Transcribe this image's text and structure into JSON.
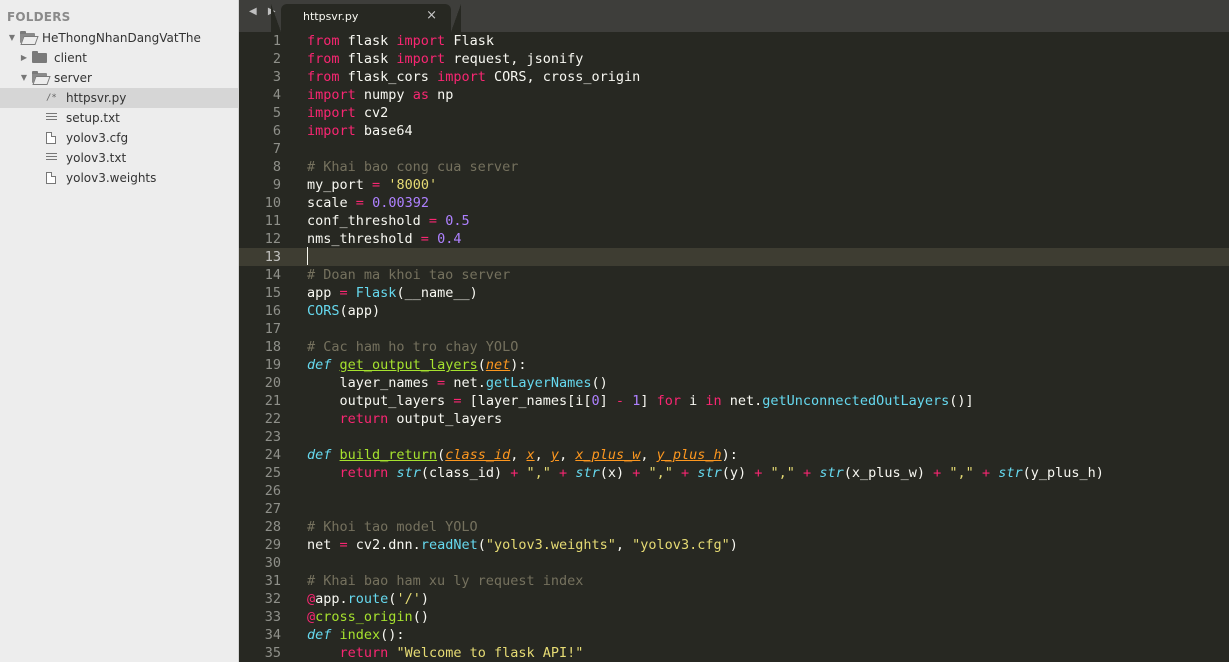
{
  "sidebar": {
    "header": "FOLDERS",
    "items": [
      {
        "label": "HeThongNhanDangVatThe",
        "kind": "folder-open",
        "depth": 0,
        "arrow": "▼"
      },
      {
        "label": "client",
        "kind": "folder",
        "depth": 1,
        "arrow": "▶"
      },
      {
        "label": "server",
        "kind": "folder-open",
        "depth": 1,
        "arrow": "▼"
      },
      {
        "label": "httpsvr.py",
        "kind": "py",
        "depth": 2,
        "selected": true,
        "icon_glyph": "/*"
      },
      {
        "label": "setup.txt",
        "kind": "txt",
        "depth": 2
      },
      {
        "label": "yolov3.cfg",
        "kind": "file",
        "depth": 2
      },
      {
        "label": "yolov3.txt",
        "kind": "txt",
        "depth": 2
      },
      {
        "label": "yolov3.weights",
        "kind": "file",
        "depth": 2
      }
    ]
  },
  "tabbar": {
    "nav_arrows": "◀ ▶",
    "active_tab": {
      "title": "httpsvr.py",
      "close_glyph": "×"
    }
  },
  "editor": {
    "current_line": 13,
    "colors": {
      "background": "#272822",
      "keyword": "#f92672",
      "comment": "#75715e",
      "string": "#e6db74",
      "number": "#ae81ff",
      "function": "#a6e22e",
      "builtin": "#66d9ef",
      "param": "#fd971f"
    },
    "lines": [
      {
        "n": "1",
        "tokens": [
          [
            "k",
            "from"
          ],
          [
            "x",
            " flask "
          ],
          [
            "k",
            "import"
          ],
          [
            "x",
            " Flask"
          ]
        ]
      },
      {
        "n": "2",
        "tokens": [
          [
            "k",
            "from"
          ],
          [
            "x",
            " flask "
          ],
          [
            "k",
            "import"
          ],
          [
            "x",
            " request, jsonify"
          ]
        ]
      },
      {
        "n": "3",
        "tokens": [
          [
            "k",
            "from"
          ],
          [
            "x",
            " flask_cors "
          ],
          [
            "k",
            "import"
          ],
          [
            "x",
            " CORS, cross_origin"
          ]
        ]
      },
      {
        "n": "4",
        "tokens": [
          [
            "k",
            "import"
          ],
          [
            "x",
            " numpy "
          ],
          [
            "k",
            "as"
          ],
          [
            "x",
            " np"
          ]
        ]
      },
      {
        "n": "5",
        "tokens": [
          [
            "k",
            "import"
          ],
          [
            "x",
            " cv2"
          ]
        ]
      },
      {
        "n": "6",
        "tokens": [
          [
            "k",
            "import"
          ],
          [
            "x",
            " base64"
          ]
        ]
      },
      {
        "n": "7",
        "tokens": []
      },
      {
        "n": "8",
        "tokens": [
          [
            "c",
            "# Khai bao cong cua server"
          ]
        ]
      },
      {
        "n": "9",
        "tokens": [
          [
            "x",
            "my_port "
          ],
          [
            "k",
            "="
          ],
          [
            "x",
            " "
          ],
          [
            "s",
            "'8000'"
          ]
        ]
      },
      {
        "n": "10",
        "tokens": [
          [
            "x",
            "scale "
          ],
          [
            "k",
            "="
          ],
          [
            "x",
            " "
          ],
          [
            "n",
            "0.00392"
          ]
        ]
      },
      {
        "n": "11",
        "tokens": [
          [
            "x",
            "conf_threshold "
          ],
          [
            "k",
            "="
          ],
          [
            "x",
            " "
          ],
          [
            "n",
            "0.5"
          ]
        ]
      },
      {
        "n": "12",
        "tokens": [
          [
            "x",
            "nms_threshold "
          ],
          [
            "k",
            "="
          ],
          [
            "x",
            " "
          ],
          [
            "n",
            "0.4"
          ]
        ]
      },
      {
        "n": "13",
        "tokens": []
      },
      {
        "n": "14",
        "tokens": [
          [
            "c",
            "# Doan ma khoi tao server"
          ]
        ]
      },
      {
        "n": "15",
        "tokens": [
          [
            "x",
            "app "
          ],
          [
            "k",
            "="
          ],
          [
            "x",
            " "
          ],
          [
            "b",
            "Flask"
          ],
          [
            "x",
            "(__name__)"
          ]
        ]
      },
      {
        "n": "16",
        "tokens": [
          [
            "b",
            "CORS"
          ],
          [
            "x",
            "(app)"
          ]
        ]
      },
      {
        "n": "17",
        "tokens": []
      },
      {
        "n": "18",
        "tokens": [
          [
            "c",
            "# Cac ham ho tro chay YOLO"
          ]
        ]
      },
      {
        "n": "19",
        "tokens": [
          [
            "bi",
            "def"
          ],
          [
            "x",
            " "
          ],
          [
            "fu",
            "get_output_layers"
          ],
          [
            "x",
            "("
          ],
          [
            "pu",
            "net"
          ],
          [
            "x",
            "):"
          ]
        ]
      },
      {
        "n": "20",
        "tokens": [
          [
            "x",
            "    layer_names "
          ],
          [
            "k",
            "="
          ],
          [
            "x",
            " net."
          ],
          [
            "b",
            "getLayerNames"
          ],
          [
            "x",
            "()"
          ]
        ]
      },
      {
        "n": "21",
        "tokens": [
          [
            "x",
            "    output_layers "
          ],
          [
            "k",
            "="
          ],
          [
            "x",
            " [layer_names[i["
          ],
          [
            "n",
            "0"
          ],
          [
            "x",
            "] "
          ],
          [
            "k",
            "-"
          ],
          [
            "x",
            " "
          ],
          [
            "n",
            "1"
          ],
          [
            "x",
            "] "
          ],
          [
            "k",
            "for"
          ],
          [
            "x",
            " i "
          ],
          [
            "k",
            "in"
          ],
          [
            "x",
            " net."
          ],
          [
            "b",
            "getUnconnectedOutLayers"
          ],
          [
            "x",
            "()]"
          ]
        ]
      },
      {
        "n": "22",
        "tokens": [
          [
            "x",
            "    "
          ],
          [
            "k",
            "return"
          ],
          [
            "x",
            " output_layers"
          ]
        ]
      },
      {
        "n": "23",
        "tokens": []
      },
      {
        "n": "24",
        "tokens": [
          [
            "bi",
            "def"
          ],
          [
            "x",
            " "
          ],
          [
            "fu",
            "build_return"
          ],
          [
            "x",
            "("
          ],
          [
            "pu",
            "class_id"
          ],
          [
            "x",
            ", "
          ],
          [
            "pu",
            "x"
          ],
          [
            "x",
            ", "
          ],
          [
            "pu",
            "y"
          ],
          [
            "x",
            ", "
          ],
          [
            "pu",
            "x_plus_w"
          ],
          [
            "x",
            ", "
          ],
          [
            "pu",
            "y_plus_h"
          ],
          [
            "x",
            "):"
          ]
        ]
      },
      {
        "n": "25",
        "tokens": [
          [
            "x",
            "    "
          ],
          [
            "k",
            "return"
          ],
          [
            "x",
            " "
          ],
          [
            "bi",
            "str"
          ],
          [
            "x",
            "(class_id) "
          ],
          [
            "k",
            "+"
          ],
          [
            "x",
            " "
          ],
          [
            "s",
            "\",\""
          ],
          [
            "x",
            " "
          ],
          [
            "k",
            "+"
          ],
          [
            "x",
            " "
          ],
          [
            "bi",
            "str"
          ],
          [
            "x",
            "(x) "
          ],
          [
            "k",
            "+"
          ],
          [
            "x",
            " "
          ],
          [
            "s",
            "\",\""
          ],
          [
            "x",
            " "
          ],
          [
            "k",
            "+"
          ],
          [
            "x",
            " "
          ],
          [
            "bi",
            "str"
          ],
          [
            "x",
            "(y) "
          ],
          [
            "k",
            "+"
          ],
          [
            "x",
            " "
          ],
          [
            "s",
            "\",\""
          ],
          [
            "x",
            " "
          ],
          [
            "k",
            "+"
          ],
          [
            "x",
            " "
          ],
          [
            "bi",
            "str"
          ],
          [
            "x",
            "(x_plus_w) "
          ],
          [
            "k",
            "+"
          ],
          [
            "x",
            " "
          ],
          [
            "s",
            "\",\""
          ],
          [
            "x",
            " "
          ],
          [
            "k",
            "+"
          ],
          [
            "x",
            " "
          ],
          [
            "bi",
            "str"
          ],
          [
            "x",
            "(y_plus_h)"
          ]
        ]
      },
      {
        "n": "26",
        "tokens": []
      },
      {
        "n": "27",
        "tokens": []
      },
      {
        "n": "28",
        "tokens": [
          [
            "c",
            "# Khoi tao model YOLO"
          ]
        ]
      },
      {
        "n": "29",
        "tokens": [
          [
            "x",
            "net "
          ],
          [
            "k",
            "="
          ],
          [
            "x",
            " cv2.dnn."
          ],
          [
            "b",
            "readNet"
          ],
          [
            "x",
            "("
          ],
          [
            "s",
            "\"yolov3.weights\""
          ],
          [
            "x",
            ", "
          ],
          [
            "s",
            "\"yolov3.cfg\""
          ],
          [
            "x",
            ")"
          ]
        ]
      },
      {
        "n": "30",
        "tokens": []
      },
      {
        "n": "31",
        "tokens": [
          [
            "c",
            "# Khai bao ham xu ly request index"
          ]
        ]
      },
      {
        "n": "32",
        "tokens": [
          [
            "k",
            "@"
          ],
          [
            "x",
            "app."
          ],
          [
            "b",
            "route"
          ],
          [
            "x",
            "("
          ],
          [
            "s",
            "'/'"
          ],
          [
            "x",
            ")"
          ]
        ]
      },
      {
        "n": "33",
        "tokens": [
          [
            "k",
            "@"
          ],
          [
            "f",
            "cross_origin"
          ],
          [
            "x",
            "()"
          ]
        ]
      },
      {
        "n": "34",
        "tokens": [
          [
            "bi",
            "def"
          ],
          [
            "x",
            " "
          ],
          [
            "f",
            "index"
          ],
          [
            "x",
            "():"
          ]
        ]
      },
      {
        "n": "35",
        "tokens": [
          [
            "x",
            "    "
          ],
          [
            "k",
            "return"
          ],
          [
            "x",
            " "
          ],
          [
            "s",
            "\"Welcome to flask API!\""
          ]
        ]
      }
    ]
  }
}
